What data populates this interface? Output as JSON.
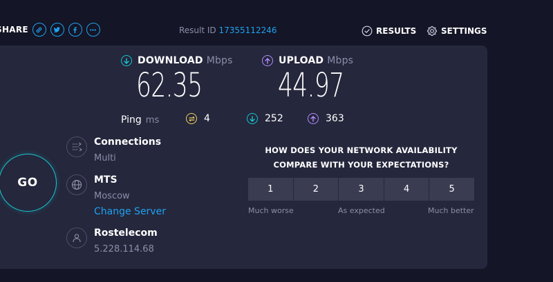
{
  "header": {
    "share_label": "SHARE",
    "share_icons": [
      "link-icon",
      "twitter-icon",
      "facebook-icon",
      "more-icon"
    ],
    "result_id_label": "Result ID",
    "result_id_value": "17355112246",
    "results_label": "RESULTS",
    "settings_label": "SETTINGS"
  },
  "download": {
    "label": "DOWNLOAD",
    "unit": "Mbps",
    "value": "62.35",
    "color": "#17c8d0"
  },
  "upload": {
    "label": "UPLOAD",
    "unit": "Mbps",
    "value": "44.97",
    "color": "#b48cff"
  },
  "ping": {
    "label": "Ping",
    "unit": "ms",
    "idle": "4",
    "download": "252",
    "upload": "363",
    "idle_color": "#f4d35e"
  },
  "go_label": "GO",
  "connections": {
    "title": "Connections",
    "value": "Multi"
  },
  "server": {
    "name": "MTS",
    "location": "Moscow",
    "change_label": "Change Server"
  },
  "isp": {
    "name": "Rostelecom",
    "ip": "5.228.114.68"
  },
  "survey": {
    "question_line1": "HOW DOES YOUR NETWORK AVAILABILITY",
    "question_line2": "COMPARE WITH YOUR EXPECTATIONS?",
    "options": [
      "1",
      "2",
      "3",
      "4",
      "5"
    ],
    "label_low": "Much worse",
    "label_mid": "As expected",
    "label_high": "Much better"
  },
  "colors": {
    "accent": "#1fa2f0",
    "background": "#141526",
    "panel": "#25273c"
  }
}
